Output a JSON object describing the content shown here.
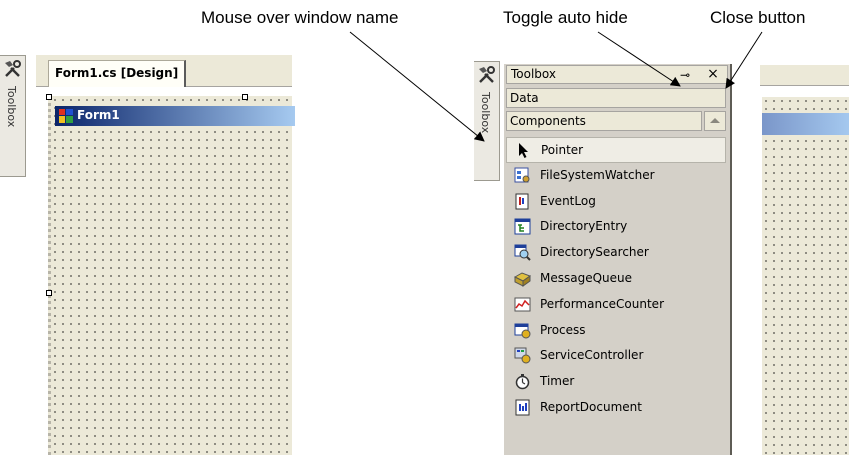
{
  "annotations": {
    "window_name": "Mouse over window name",
    "auto_hide": "Toggle auto hide",
    "close_button": "Close button"
  },
  "left": {
    "side_tab_label": "Toolbox",
    "doc_tab_label": "Form1.cs [Design]",
    "form_title": "Form1"
  },
  "right": {
    "side_tab_label": "Toolbox",
    "toolbox": {
      "title": "Toolbox",
      "pin_glyph": "⊸",
      "close_glyph": "×",
      "categories": [
        "Data",
        "Components"
      ],
      "items": [
        {
          "label": "Pointer",
          "icon": "pointer-icon"
        },
        {
          "label": "FileSystemWatcher",
          "icon": "filesystemwatcher-icon"
        },
        {
          "label": "EventLog",
          "icon": "eventlog-icon"
        },
        {
          "label": "DirectoryEntry",
          "icon": "directoryentry-icon"
        },
        {
          "label": "DirectorySearcher",
          "icon": "directorysearcher-icon"
        },
        {
          "label": "MessageQueue",
          "icon": "messagequeue-icon"
        },
        {
          "label": "PerformanceCounter",
          "icon": "performancecounter-icon"
        },
        {
          "label": "Process",
          "icon": "process-icon"
        },
        {
          "label": "ServiceController",
          "icon": "servicecontroller-icon"
        },
        {
          "label": "Timer",
          "icon": "timer-icon"
        },
        {
          "label": "ReportDocument",
          "icon": "reportdocument-icon"
        }
      ]
    }
  },
  "colors": {
    "titlebar_start": "#0a246a",
    "titlebar_end": "#a6caf0",
    "panel_bg": "#d4d0c8",
    "tab_bg": "#ece9d8"
  }
}
